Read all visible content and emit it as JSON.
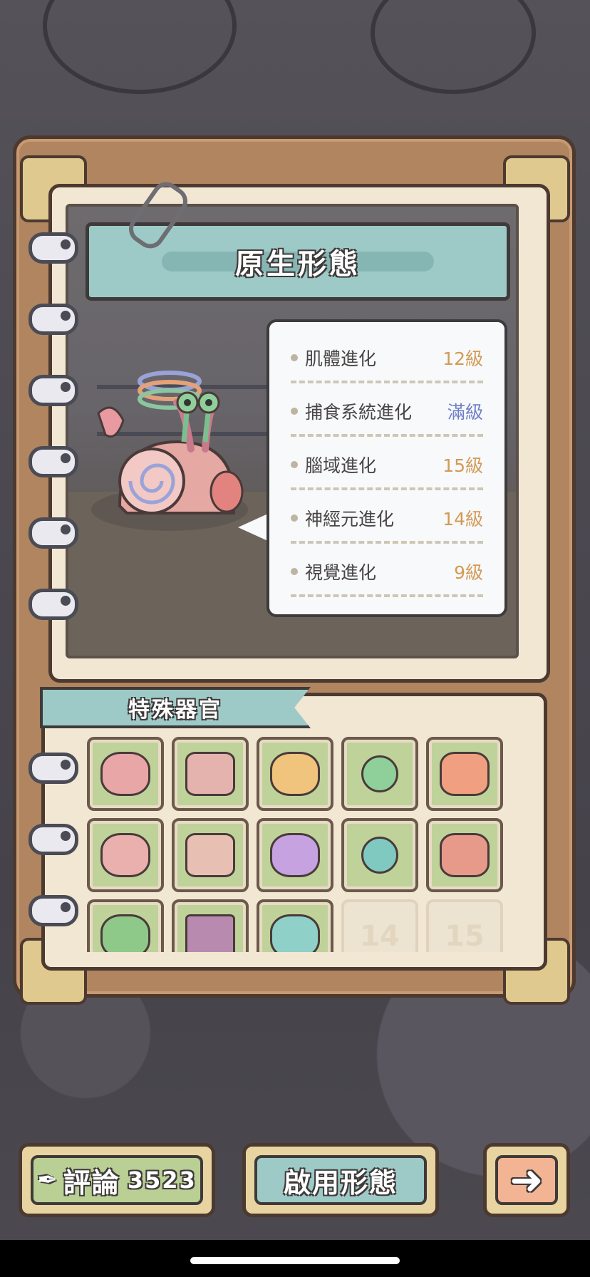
{
  "page": {
    "title": "原生形態"
  },
  "stats": [
    {
      "name": "肌體進化",
      "value": "12級",
      "max": false
    },
    {
      "name": "捕食系統進化",
      "value": "滿級",
      "max": true
    },
    {
      "name": "腦域進化",
      "value": "15級",
      "max": false
    },
    {
      "name": "神經元進化",
      "value": "14級",
      "max": false
    },
    {
      "name": "視覺進化",
      "value": "9級",
      "max": false
    }
  ],
  "organs": {
    "title": "特殊器官",
    "locked_slots": [
      "14",
      "15"
    ]
  },
  "footer": {
    "comment_label": "評論",
    "comment_count": "3523",
    "activate_label": "啟用形態"
  },
  "colors": {
    "accent_teal": "#9dcac7",
    "slot_green": "#bfd29a",
    "level_orange": "#d39a55",
    "max_blue": "#6f7fc4",
    "comment_green": "#b9cf94",
    "arrow_peach": "#f2b493"
  }
}
